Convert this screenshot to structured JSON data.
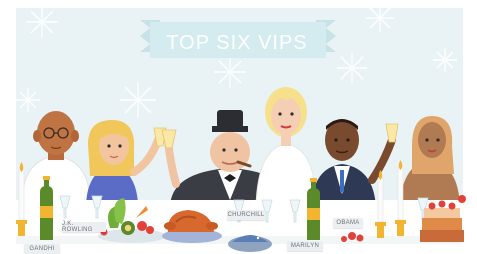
{
  "banner": {
    "title": "TOP SIX VIPS"
  },
  "place_cards": [
    {
      "label": "J.K. ROWLING"
    },
    {
      "label": "CHURCHILL"
    },
    {
      "label": "OBAMA"
    },
    {
      "label": "MARILYN"
    },
    {
      "label": "GANDHI"
    }
  ],
  "colors": {
    "background": "#e9f3f5",
    "banner": "#d7eef1",
    "tablecloth": "#ffffff",
    "accent_gold": "#f2b531",
    "bottle_green": "#5b8a2b"
  }
}
